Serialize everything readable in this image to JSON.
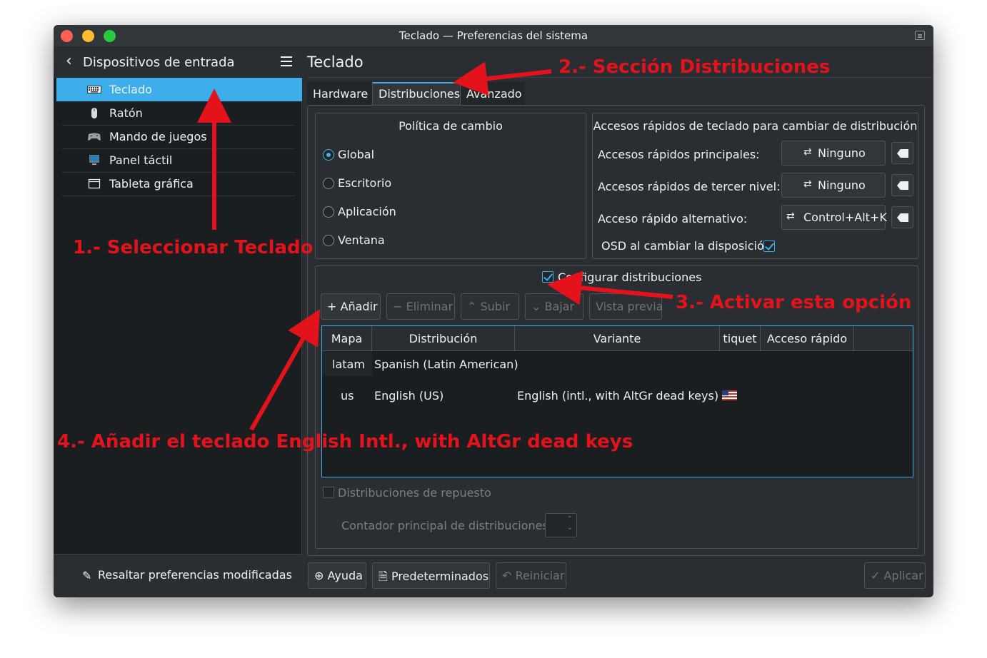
{
  "window": {
    "title": "Teclado — Preferencias del sistema"
  },
  "sidebar": {
    "header": "Dispositivos de entrada",
    "items": [
      {
        "label": "Teclado",
        "icon": "keyboard-icon"
      },
      {
        "label": "Ratón",
        "icon": "mouse-icon"
      },
      {
        "label": "Mando de juegos",
        "icon": "gamepad-icon"
      },
      {
        "label": "Panel táctil",
        "icon": "touchpad-icon"
      },
      {
        "label": "Tableta gráfica",
        "icon": "tablet-icon"
      }
    ],
    "footer": "Resaltar preferencias modificadas"
  },
  "main": {
    "title": "Teclado",
    "tabs": [
      "Hardware",
      "Distribuciones",
      "Avanzado"
    ],
    "policy": {
      "title": "Política de cambio",
      "options": [
        "Global",
        "Escritorio",
        "Aplicación",
        "Ventana"
      ],
      "selected": "Global"
    },
    "shortcuts": {
      "title": "Accesos rápidos de teclado para cambiar de distribución",
      "rows": [
        {
          "label": "Accesos rápidos principales:",
          "value": "Ninguno"
        },
        {
          "label": "Accesos rápidos de tercer nivel:",
          "value": "Ninguno"
        },
        {
          "label": "Acceso rápido alternativo:",
          "value": "Control+Alt+K"
        }
      ],
      "osd_label": "OSD al cambiar la disposición",
      "osd_checked": true
    },
    "layouts": {
      "configure_label": "Configurar distribuciones",
      "configure_checked": true,
      "toolbar": {
        "add": "Añadir",
        "remove": "Eliminar",
        "up": "Subir",
        "down": "Bajar",
        "preview": "Vista previa"
      },
      "columns": [
        "Mapa",
        "Distribución",
        "Variante",
        "tiquet",
        "Acceso rápido"
      ],
      "rows": [
        {
          "map": "latam",
          "layout": "Spanish (Latin American)",
          "variant": "",
          "flag": ""
        },
        {
          "map": "us",
          "layout": "English (US)",
          "variant": "English (intl., with AltGr dead keys)",
          "flag": "us-flag-icon"
        }
      ],
      "spare_label": "Distribuciones de repuesto",
      "counter_label": "Contador principal de distribuciones:"
    },
    "bottom": {
      "help": "Ayuda",
      "defaults": "Predeterminados",
      "reset": "Reiniciar",
      "apply": "Aplicar"
    }
  },
  "annotations": {
    "step1": "1.- Seleccionar Teclado",
    "step2": "2.- Sección Distribuciones",
    "step3": "3.- Activar esta opción",
    "step4": "4.- Añadir el teclado English Intl., with AltGr dead keys"
  },
  "colors": {
    "accent": "#3daee9",
    "annotation": "#e4131b",
    "background": "#2a2e32"
  }
}
